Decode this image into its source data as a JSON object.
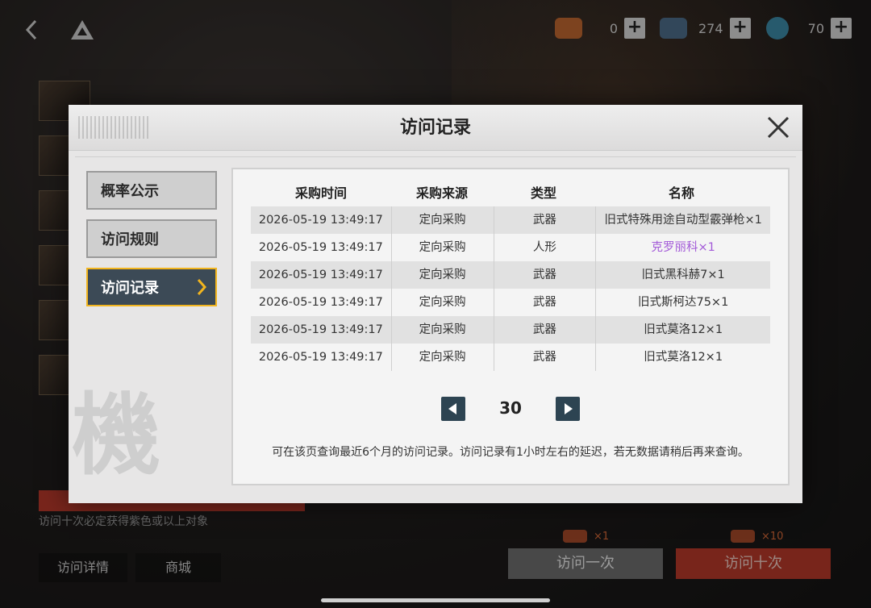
{
  "resources": [
    {
      "icon": "ticket-icon",
      "value": "0",
      "plus": "+"
    },
    {
      "icon": "crystal-icon",
      "value": "274",
      "plus": "+"
    },
    {
      "icon": "core-icon",
      "value": "70",
      "plus": "+"
    }
  ],
  "background": {
    "subtitle": "访问十次必定获得紫色或以上对象",
    "detail_button": "访问详情",
    "shop_button": "商城",
    "cost_once": "×1",
    "cost_ten": "×10",
    "visit_once": "访问一次",
    "visit_ten": "访问十次"
  },
  "modal": {
    "title": "访问记录",
    "watermark": "機",
    "sidebar": [
      {
        "label": "概率公示",
        "active": false
      },
      {
        "label": "访问规则",
        "active": false
      },
      {
        "label": "访问记录",
        "active": true
      }
    ],
    "columns": [
      "采购时间",
      "采购来源",
      "类型",
      "名称"
    ],
    "rows": [
      {
        "time": "2026-05-19 13:49:17",
        "source": "定向采购",
        "type": "武器",
        "name": "旧式特殊用途自动型霰弹枪×1"
      },
      {
        "time": "2026-05-19 13:49:17",
        "source": "定向采购",
        "type": "人形",
        "name": "克罗丽科×1"
      },
      {
        "time": "2026-05-19 13:49:17",
        "source": "定向采购",
        "type": "武器",
        "name": "旧式黑科赫7×1"
      },
      {
        "time": "2026-05-19 13:49:17",
        "source": "定向采购",
        "type": "武器",
        "name": "旧式斯柯达75×1"
      },
      {
        "time": "2026-05-19 13:49:17",
        "source": "定向采购",
        "type": "武器",
        "name": "旧式莫洛12×1"
      },
      {
        "time": "2026-05-19 13:49:17",
        "source": "定向采购",
        "type": "武器",
        "name": "旧式莫洛12×1"
      }
    ],
    "page": "30",
    "note": "可在该页查询最近6个月的访问记录。访问记录有1小时左右的延迟，若无数据请稍后再来查询。"
  },
  "colors": {
    "accent": "#f2b51e",
    "active_tab": "#3c4a56",
    "purple_item": "#a35ad8",
    "visit_ten": "#b83a2a"
  }
}
